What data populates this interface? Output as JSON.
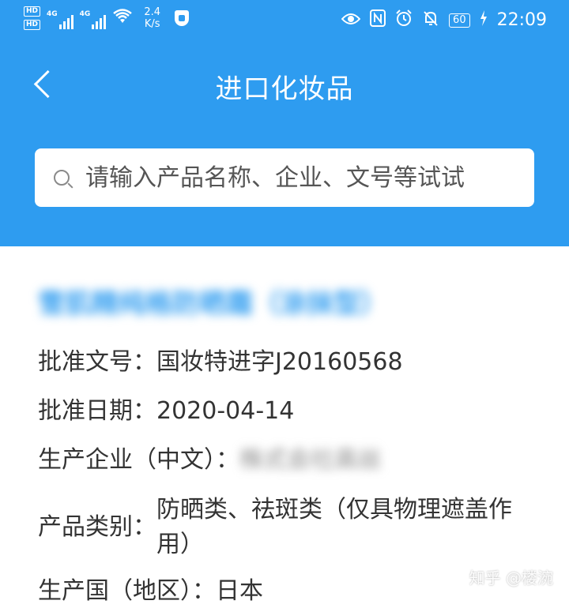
{
  "status_bar": {
    "hd_badge": "HD",
    "network_label": "4G",
    "speed_value": "2.4",
    "speed_unit": "K/s",
    "battery": "60",
    "time": "22:09"
  },
  "nav": {
    "title": "进口化妆品"
  },
  "search": {
    "placeholder": "请输入产品名称、企业、文号等试试"
  },
  "product": {
    "name": "雪肌精纯格防晒霜（涂抹型）",
    "fields": [
      {
        "label": "批准文号：",
        "value": "国妆特进字J20160568"
      },
      {
        "label": "批准日期：",
        "value": "2020-04-14"
      },
      {
        "label": "生产企业（中文）：",
        "value": "株式会社高丝"
      },
      {
        "label": "产品类别：",
        "value": "防晒类、祛斑类（仅具物理遮盖作用）"
      },
      {
        "label": "生产国（地区）：",
        "value": "日本"
      }
    ]
  },
  "watermark": "知乎 @楼涴"
}
